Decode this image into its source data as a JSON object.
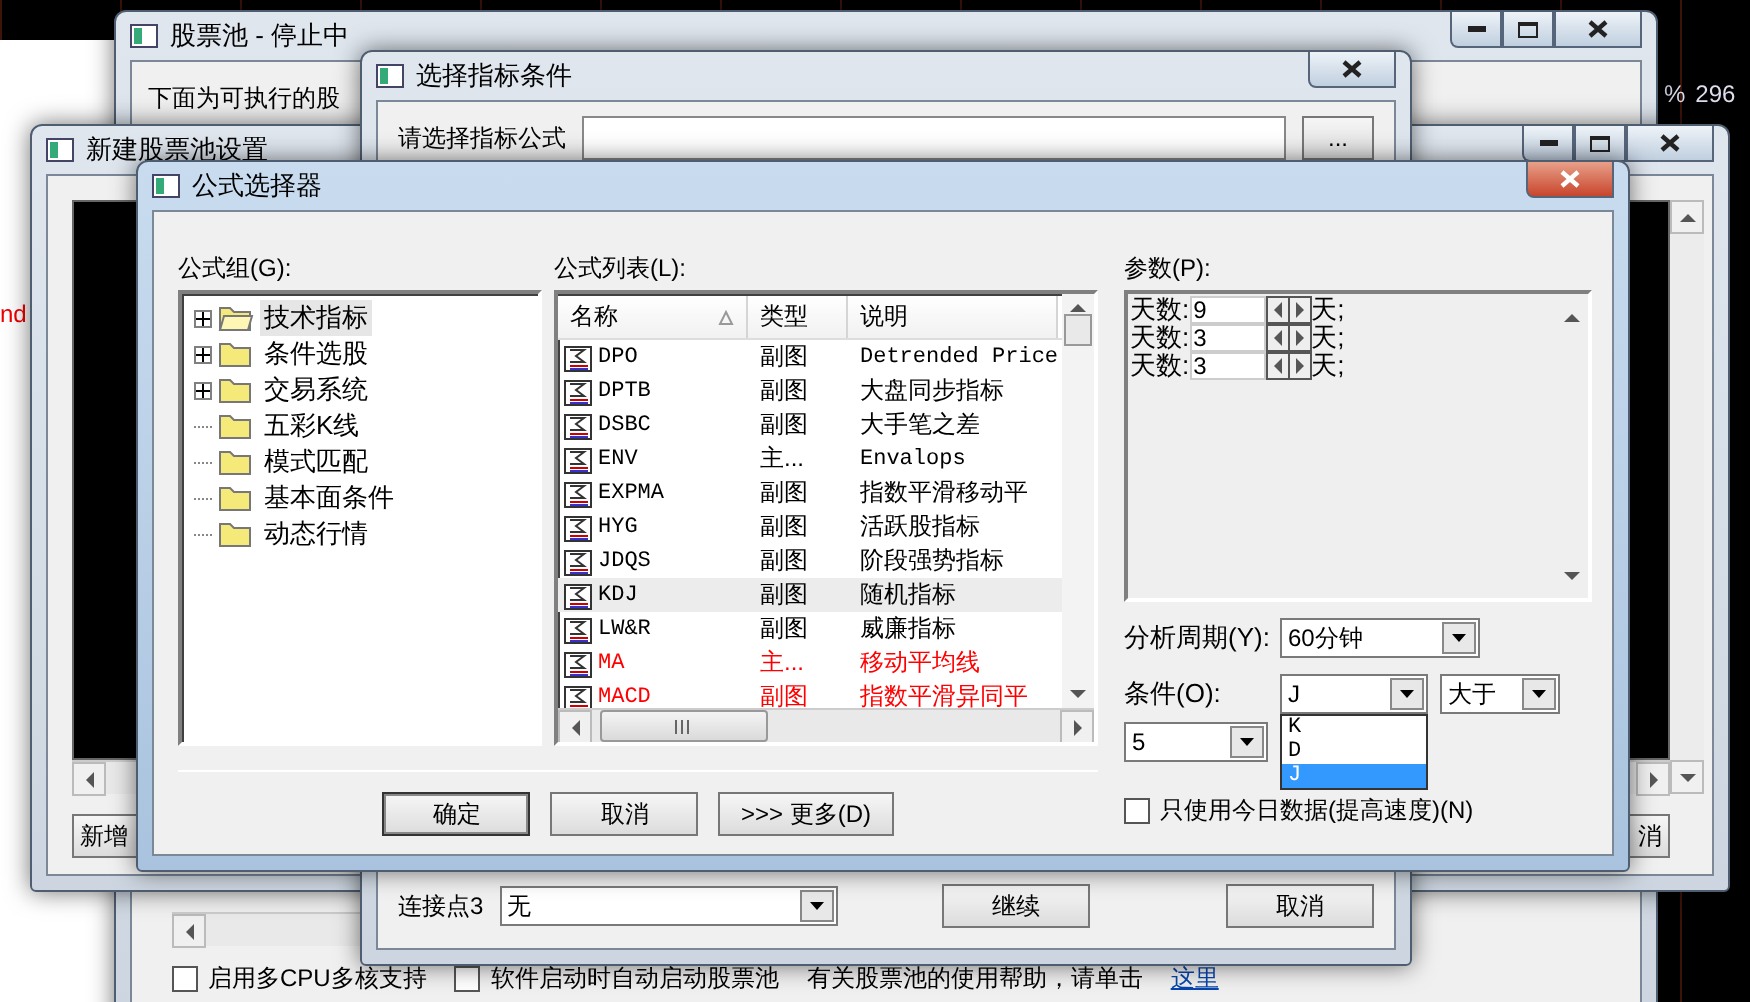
{
  "background": {
    "ticker_percent": "%",
    "ticker_value": "296",
    "side_text": "nd"
  },
  "pool_window": {
    "title": "股票池 - 停止中",
    "intro": "下面为可执行的股",
    "checkboxes": [
      {
        "label": "启用多CPU多核支持",
        "checked": false
      },
      {
        "label": "软件启动时自动启动股票池",
        "checked": false
      }
    ],
    "help_text": "有关股票池的使用帮助，请单击",
    "help_link": "这里"
  },
  "indicator_window": {
    "title": "选择指标条件",
    "formula_label": "请选择指标公式",
    "browse_button": "...",
    "connect_label": "连接点3",
    "connect_value": "无",
    "buttons": [
      "继续",
      "取消"
    ]
  },
  "setup_window": {
    "title": "新建股票池设置",
    "buttons": [
      "新增",
      "消"
    ]
  },
  "selector": {
    "title": "公式选择器",
    "group_label": "公式组(G):",
    "tree": [
      {
        "label": "技术指标",
        "expandable": true,
        "selected": true
      },
      {
        "label": "条件选股",
        "expandable": true,
        "selected": false
      },
      {
        "label": "交易系统",
        "expandable": true,
        "selected": false
      },
      {
        "label": "五彩K线",
        "expandable": false,
        "selected": false
      },
      {
        "label": "模式匹配",
        "expandable": false,
        "selected": false
      },
      {
        "label": "基本面条件",
        "expandable": false,
        "selected": false
      },
      {
        "label": "动态行情",
        "expandable": false,
        "selected": false
      }
    ],
    "list_label": "公式列表(L):",
    "columns": [
      "名称",
      "类型",
      "说明"
    ],
    "rows": [
      {
        "name": "DPO",
        "type": "副图",
        "desc": "Detrended Price",
        "selected": false,
        "highlighted": false
      },
      {
        "name": "DPTB",
        "type": "副图",
        "desc": "大盘同步指标",
        "selected": false,
        "highlighted": false
      },
      {
        "name": "DSBC",
        "type": "副图",
        "desc": "大手笔之差",
        "selected": false,
        "highlighted": false
      },
      {
        "name": "ENV",
        "type": "主...",
        "desc": "Envalops",
        "selected": false,
        "highlighted": false
      },
      {
        "name": "EXPMA",
        "type": "副图",
        "desc": "指数平滑移动平",
        "selected": false,
        "highlighted": false
      },
      {
        "name": "HYG",
        "type": "副图",
        "desc": "活跃股指标",
        "selected": false,
        "highlighted": false
      },
      {
        "name": "JDQS",
        "type": "副图",
        "desc": "阶段强势指标",
        "selected": false,
        "highlighted": false
      },
      {
        "name": "KDJ",
        "type": "副图",
        "desc": "随机指标",
        "selected": true,
        "highlighted": false
      },
      {
        "name": "LW&R",
        "type": "副图",
        "desc": "威廉指标",
        "selected": false,
        "highlighted": false
      },
      {
        "name": "MA",
        "type": "主...",
        "desc": "移动平均线",
        "selected": false,
        "highlighted": true
      },
      {
        "name": "MACD",
        "type": "副图",
        "desc": "指数平滑异同平",
        "selected": false,
        "highlighted": true
      }
    ],
    "params_label": "参数(P):",
    "params": [
      {
        "label": "天数:",
        "value": "9",
        "unit": "天;"
      },
      {
        "label": "天数:",
        "value": "3",
        "unit": "天;"
      },
      {
        "label": "天数:",
        "value": "3",
        "unit": "天;"
      }
    ],
    "period_label": "分析周期(Y):",
    "period": "60分钟",
    "condition_label": "条件(O):",
    "condition_line": "J",
    "condition_op": "大于",
    "condition_value": "5",
    "line_options": [
      {
        "label": "K",
        "selected": false
      },
      {
        "label": "D",
        "selected": false
      },
      {
        "label": "J",
        "selected": true
      }
    ],
    "today_only": {
      "label": "只使用今日数据(提高速度)(N)",
      "checked": false
    },
    "buttons": [
      {
        "label": "确定",
        "default": true
      },
      {
        "label": "取消",
        "default": false
      },
      {
        "label": ">>> 更多(D)",
        "default": false
      }
    ]
  }
}
